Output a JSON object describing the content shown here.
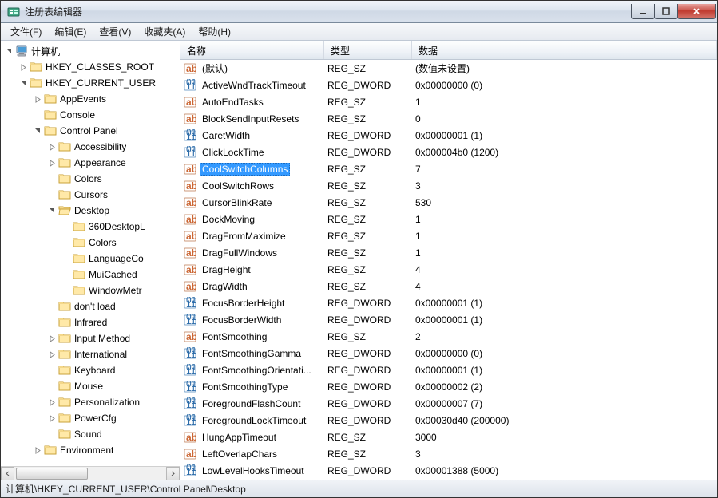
{
  "window": {
    "title": "注册表编辑器"
  },
  "menu": [
    "文件(F)",
    "编辑(E)",
    "查看(V)",
    "收藏夹(A)",
    "帮助(H)"
  ],
  "tree": [
    {
      "depth": 0,
      "exp": "open",
      "icon": "computer",
      "label": "计算机"
    },
    {
      "depth": 1,
      "exp": "closed",
      "icon": "folder",
      "label": "HKEY_CLASSES_ROOT"
    },
    {
      "depth": 1,
      "exp": "open",
      "icon": "folder",
      "label": "HKEY_CURRENT_USER"
    },
    {
      "depth": 2,
      "exp": "closed",
      "icon": "folder",
      "label": "AppEvents"
    },
    {
      "depth": 2,
      "exp": "none",
      "icon": "folder",
      "label": "Console"
    },
    {
      "depth": 2,
      "exp": "open",
      "icon": "folder",
      "label": "Control Panel"
    },
    {
      "depth": 3,
      "exp": "closed",
      "icon": "folder",
      "label": "Accessibility"
    },
    {
      "depth": 3,
      "exp": "closed",
      "icon": "folder",
      "label": "Appearance"
    },
    {
      "depth": 3,
      "exp": "none",
      "icon": "folder",
      "label": "Colors"
    },
    {
      "depth": 3,
      "exp": "none",
      "icon": "folder",
      "label": "Cursors"
    },
    {
      "depth": 3,
      "exp": "open",
      "icon": "folder-open",
      "label": "Desktop"
    },
    {
      "depth": 4,
      "exp": "none",
      "icon": "folder",
      "label": "360DesktopL"
    },
    {
      "depth": 4,
      "exp": "none",
      "icon": "folder",
      "label": "Colors"
    },
    {
      "depth": 4,
      "exp": "none",
      "icon": "folder",
      "label": "LanguageCo"
    },
    {
      "depth": 4,
      "exp": "none",
      "icon": "folder",
      "label": "MuiCached"
    },
    {
      "depth": 4,
      "exp": "none",
      "icon": "folder",
      "label": "WindowMetr"
    },
    {
      "depth": 3,
      "exp": "none",
      "icon": "folder",
      "label": "don't load"
    },
    {
      "depth": 3,
      "exp": "none",
      "icon": "folder",
      "label": "Infrared"
    },
    {
      "depth": 3,
      "exp": "closed",
      "icon": "folder",
      "label": "Input Method"
    },
    {
      "depth": 3,
      "exp": "closed",
      "icon": "folder",
      "label": "International"
    },
    {
      "depth": 3,
      "exp": "none",
      "icon": "folder",
      "label": "Keyboard"
    },
    {
      "depth": 3,
      "exp": "none",
      "icon": "folder",
      "label": "Mouse"
    },
    {
      "depth": 3,
      "exp": "closed",
      "icon": "folder",
      "label": "Personalization"
    },
    {
      "depth": 3,
      "exp": "closed",
      "icon": "folder",
      "label": "PowerCfg"
    },
    {
      "depth": 3,
      "exp": "none",
      "icon": "folder",
      "label": "Sound"
    },
    {
      "depth": 2,
      "exp": "closed",
      "icon": "folder",
      "label": "Environment"
    }
  ],
  "list": {
    "headers": {
      "name": "名称",
      "type": "类型",
      "data": "数据"
    },
    "rows": [
      {
        "icon": "sz",
        "name": "(默认)",
        "type": "REG_SZ",
        "data": "(数值未设置)"
      },
      {
        "icon": "dword",
        "name": "ActiveWndTrackTimeout",
        "type": "REG_DWORD",
        "data": "0x00000000 (0)"
      },
      {
        "icon": "sz",
        "name": "AutoEndTasks",
        "type": "REG_SZ",
        "data": "1"
      },
      {
        "icon": "sz",
        "name": "BlockSendInputResets",
        "type": "REG_SZ",
        "data": "0"
      },
      {
        "icon": "dword",
        "name": "CaretWidth",
        "type": "REG_DWORD",
        "data": "0x00000001 (1)"
      },
      {
        "icon": "dword",
        "name": "ClickLockTime",
        "type": "REG_DWORD",
        "data": "0x000004b0 (1200)"
      },
      {
        "icon": "sz",
        "name": "CoolSwitchColumns",
        "type": "REG_SZ",
        "data": "7",
        "selected": true
      },
      {
        "icon": "sz",
        "name": "CoolSwitchRows",
        "type": "REG_SZ",
        "data": "3"
      },
      {
        "icon": "sz",
        "name": "CursorBlinkRate",
        "type": "REG_SZ",
        "data": "530"
      },
      {
        "icon": "sz",
        "name": "DockMoving",
        "type": "REG_SZ",
        "data": "1"
      },
      {
        "icon": "sz",
        "name": "DragFromMaximize",
        "type": "REG_SZ",
        "data": "1"
      },
      {
        "icon": "sz",
        "name": "DragFullWindows",
        "type": "REG_SZ",
        "data": "1"
      },
      {
        "icon": "sz",
        "name": "DragHeight",
        "type": "REG_SZ",
        "data": "4"
      },
      {
        "icon": "sz",
        "name": "DragWidth",
        "type": "REG_SZ",
        "data": "4"
      },
      {
        "icon": "dword",
        "name": "FocusBorderHeight",
        "type": "REG_DWORD",
        "data": "0x00000001 (1)"
      },
      {
        "icon": "dword",
        "name": "FocusBorderWidth",
        "type": "REG_DWORD",
        "data": "0x00000001 (1)"
      },
      {
        "icon": "sz",
        "name": "FontSmoothing",
        "type": "REG_SZ",
        "data": "2"
      },
      {
        "icon": "dword",
        "name": "FontSmoothingGamma",
        "type": "REG_DWORD",
        "data": "0x00000000 (0)"
      },
      {
        "icon": "dword",
        "name": "FontSmoothingOrientati...",
        "type": "REG_DWORD",
        "data": "0x00000001 (1)"
      },
      {
        "icon": "dword",
        "name": "FontSmoothingType",
        "type": "REG_DWORD",
        "data": "0x00000002 (2)"
      },
      {
        "icon": "dword",
        "name": "ForegroundFlashCount",
        "type": "REG_DWORD",
        "data": "0x00000007 (7)"
      },
      {
        "icon": "dword",
        "name": "ForegroundLockTimeout",
        "type": "REG_DWORD",
        "data": "0x00030d40 (200000)"
      },
      {
        "icon": "sz",
        "name": "HungAppTimeout",
        "type": "REG_SZ",
        "data": "3000"
      },
      {
        "icon": "sz",
        "name": "LeftOverlapChars",
        "type": "REG_SZ",
        "data": "3"
      },
      {
        "icon": "dword",
        "name": "LowLevelHooksTimeout",
        "type": "REG_DWORD",
        "data": "0x00001388 (5000)"
      }
    ]
  },
  "statusbar": "计算机\\HKEY_CURRENT_USER\\Control Panel\\Desktop"
}
